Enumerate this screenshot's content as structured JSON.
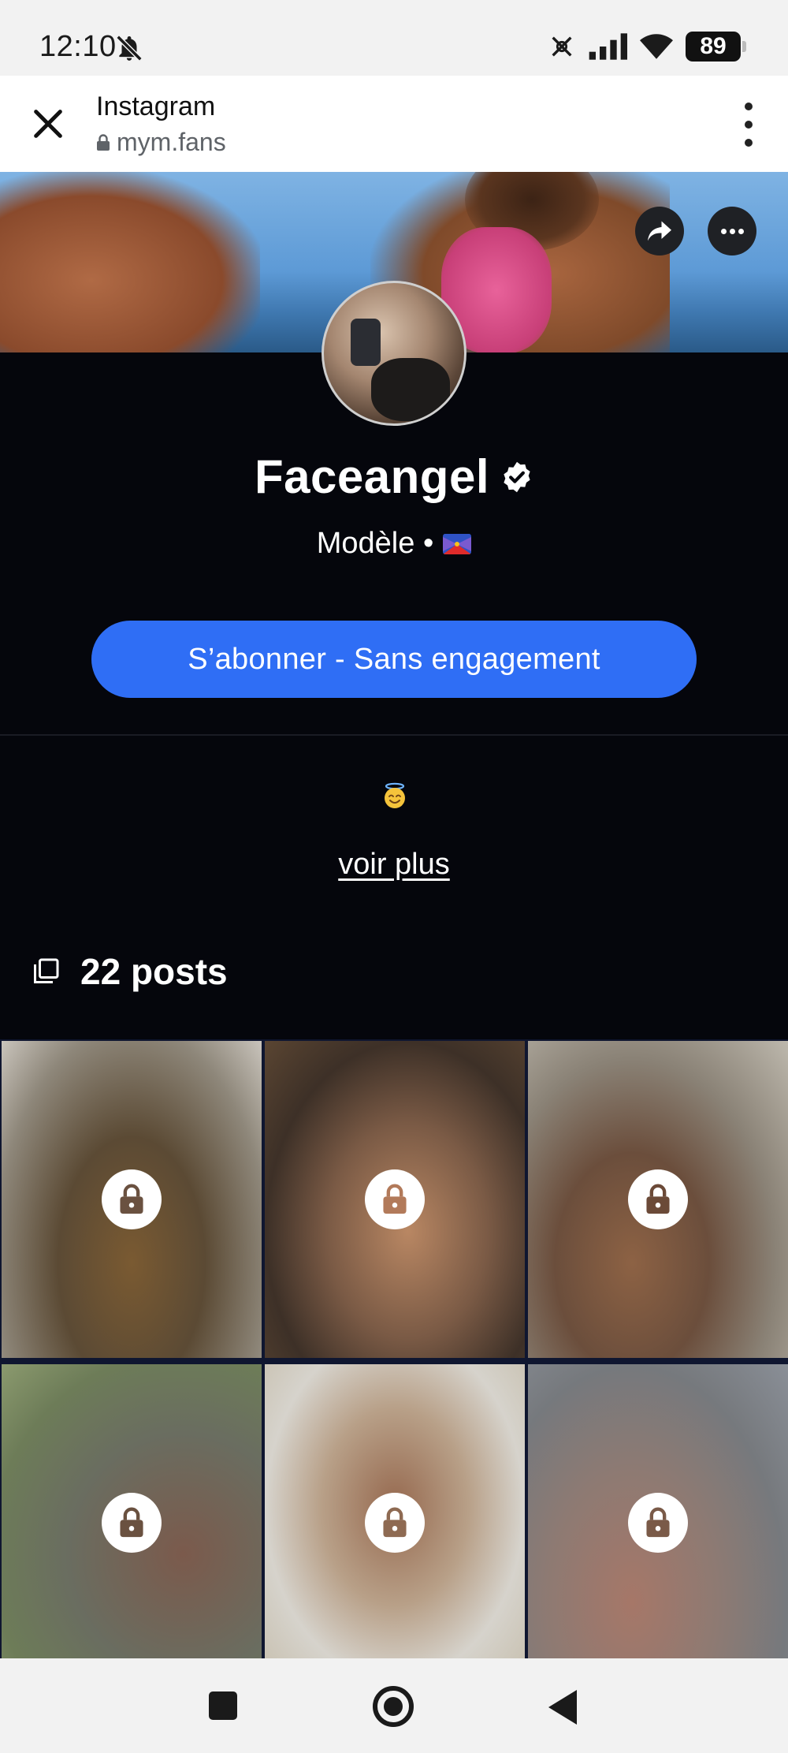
{
  "status_bar": {
    "time": "12:10",
    "battery": "89",
    "icons": [
      "bell-off-icon",
      "data-saver-icon",
      "signal-icon",
      "wifi-icon",
      "battery-icon"
    ]
  },
  "browser": {
    "title": "Instagram",
    "url": "mym.fans",
    "icons": [
      "close-icon",
      "lock-icon",
      "more-vert-icon"
    ]
  },
  "cover": {
    "buttons": [
      "share-icon",
      "more-horiz-icon"
    ]
  },
  "profile": {
    "name": "Faceangel",
    "subtitle": "Modèle •",
    "verified": true,
    "flag_icon": "reunion-flag-icon",
    "subscribe_label": "S’abonner - Sans engagement",
    "bio_emoji": "😇",
    "see_more_label": "voir plus",
    "posts_count_label": "22 posts"
  },
  "posts": [
    {
      "locked": true
    },
    {
      "locked": true
    },
    {
      "locked": true
    },
    {
      "locked": true
    },
    {
      "locked": true
    },
    {
      "locked": true
    }
  ],
  "colors": {
    "accent": "#2f6ef5",
    "background": "#05060c",
    "text": "#ffffff"
  },
  "nav_bar": {
    "icons": [
      "recents-icon",
      "home-icon",
      "back-icon"
    ]
  }
}
